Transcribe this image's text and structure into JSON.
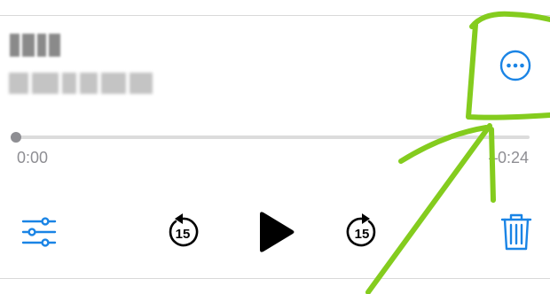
{
  "recording": {
    "title": "",
    "subtitle": "",
    "elapsed": "0:00",
    "remaining": "–0:24",
    "progress": 0
  },
  "controls": {
    "more": "more-options-icon",
    "settings": "sliders-icon",
    "skip_back": "15",
    "skip_forward": "15",
    "play": "play-icon",
    "delete": "trash-icon"
  },
  "colors": {
    "accent": "#1a84e5",
    "text_secondary": "#8e8e93",
    "track": "#dcdcdc",
    "annotation": "#84cc1e"
  }
}
